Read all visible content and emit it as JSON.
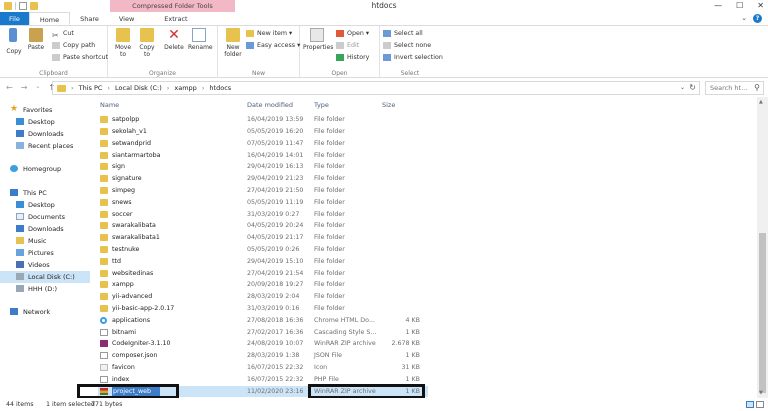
{
  "window": {
    "title": "htdocs",
    "context_tab": "Compressed Folder Tools",
    "controls": [
      "—",
      "☐",
      "✕"
    ]
  },
  "tabs": [
    "File",
    "Home",
    "Share",
    "View",
    "Extract"
  ],
  "ribbon": {
    "clipboard": {
      "label": "Clipboard",
      "pin": "Pin to Quick access",
      "copy": "Copy",
      "paste": "Paste",
      "cut": "Cut",
      "copy_path": "Copy path",
      "paste_shortcut": "Paste shortcut"
    },
    "organize": {
      "label": "Organize",
      "move_to": "Move to",
      "copy_to": "Copy to",
      "delete": "Delete",
      "rename": "Rename"
    },
    "new": {
      "label": "New",
      "new_folder": "New folder",
      "new_item": "New item ▾",
      "easy_access": "Easy access ▾"
    },
    "open": {
      "label": "Open",
      "properties": "Properties",
      "open": "Open ▾",
      "edit": "Edit",
      "history": "History"
    },
    "select": {
      "label": "Select",
      "select_all": "Select all",
      "select_none": "Select none",
      "invert": "Invert selection"
    }
  },
  "address": {
    "crumbs": [
      "This PC",
      "Local Disk (C:)",
      "xampp",
      "htdocs"
    ],
    "search_placeholder": "Search ht..."
  },
  "nav": {
    "favorites": "Favorites",
    "desktop": "Desktop",
    "downloads": "Downloads",
    "recent": "Recent places",
    "homegroup": "Homegroup",
    "this_pc": "This PC",
    "desktop2": "Desktop",
    "documents": "Documents",
    "downloads2": "Downloads",
    "music": "Music",
    "pictures": "Pictures",
    "videos": "Videos",
    "local_disk": "Local Disk (C:)",
    "hhh": "HHH (D:)",
    "network": "Network"
  },
  "columns": {
    "name": "Name",
    "date": "Date modified",
    "type": "Type",
    "size": "Size"
  },
  "files": [
    {
      "name": "satpolpp",
      "date": "16/04/2019 13:59",
      "type": "File folder",
      "size": "",
      "icon": "folder"
    },
    {
      "name": "sekolah_v1",
      "date": "05/05/2019 16:20",
      "type": "File folder",
      "size": "",
      "icon": "folder"
    },
    {
      "name": "setwandprid",
      "date": "07/05/2019 11:47",
      "type": "File folder",
      "size": "",
      "icon": "folder"
    },
    {
      "name": "siantarmartoba",
      "date": "16/04/2019 14:01",
      "type": "File folder",
      "size": "",
      "icon": "folder"
    },
    {
      "name": "sign",
      "date": "29/04/2019 16:13",
      "type": "File folder",
      "size": "",
      "icon": "folder"
    },
    {
      "name": "signature",
      "date": "29/04/2019 21:23",
      "type": "File folder",
      "size": "",
      "icon": "folder"
    },
    {
      "name": "simpeg",
      "date": "27/04/2019 21:50",
      "type": "File folder",
      "size": "",
      "icon": "folder"
    },
    {
      "name": "snews",
      "date": "05/05/2019 11:19",
      "type": "File folder",
      "size": "",
      "icon": "folder"
    },
    {
      "name": "soccer",
      "date": "31/03/2019 0:27",
      "type": "File folder",
      "size": "",
      "icon": "folder"
    },
    {
      "name": "swarakalibata",
      "date": "04/05/2019 20:24",
      "type": "File folder",
      "size": "",
      "icon": "folder"
    },
    {
      "name": "swarakalibata1",
      "date": "04/05/2019 21:17",
      "type": "File folder",
      "size": "",
      "icon": "folder"
    },
    {
      "name": "testnuke",
      "date": "05/05/2019 0:26",
      "type": "File folder",
      "size": "",
      "icon": "folder"
    },
    {
      "name": "ttd",
      "date": "29/04/2019 15:10",
      "type": "File folder",
      "size": "",
      "icon": "folder"
    },
    {
      "name": "websitedinas",
      "date": "27/04/2019 21:54",
      "type": "File folder",
      "size": "",
      "icon": "folder"
    },
    {
      "name": "xampp",
      "date": "20/09/2018 19:27",
      "type": "File folder",
      "size": "",
      "icon": "folder"
    },
    {
      "name": "yii-advanced",
      "date": "28/03/2019 2:04",
      "type": "File folder",
      "size": "",
      "icon": "folder"
    },
    {
      "name": "yii-basic-app-2.0.17",
      "date": "31/03/2019 0:16",
      "type": "File folder",
      "size": "",
      "icon": "folder"
    },
    {
      "name": "applications",
      "date": "27/08/2018 16:36",
      "type": "Chrome HTML Do...",
      "size": "4 KB",
      "icon": "chrome"
    },
    {
      "name": "bitnami",
      "date": "27/02/2017 16:36",
      "type": "Cascading Style S...",
      "size": "1 KB",
      "icon": "css"
    },
    {
      "name": "CodeIgniter-3.1.10",
      "date": "24/08/2019 10:07",
      "type": "WinRAR ZIP archive",
      "size": "2.678 KB",
      "icon": "rar"
    },
    {
      "name": "composer.json",
      "date": "28/03/2019 1:38",
      "type": "JSON File",
      "size": "1 KB",
      "icon": "json"
    },
    {
      "name": "favicon",
      "date": "16/07/2015 22:32",
      "type": "Icon",
      "size": "31 KB",
      "icon": "icon"
    },
    {
      "name": "index",
      "date": "16/07/2015 22:32",
      "type": "PHP File",
      "size": "1 KB",
      "icon": "php"
    },
    {
      "name": "project_web",
      "date": "11/02/2020 23:16",
      "type": "WinRAR ZIP archive",
      "size": "1 KB",
      "icon": "rar2",
      "selected": true
    }
  ],
  "status": {
    "items": "44 items",
    "selected": "1 item selected",
    "size": "771 bytes"
  }
}
